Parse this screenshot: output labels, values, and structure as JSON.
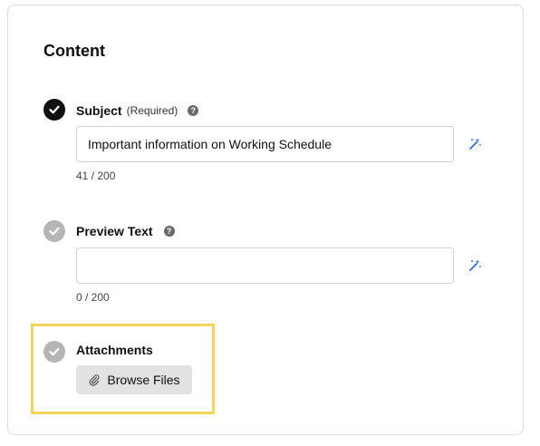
{
  "section": {
    "title": "Content"
  },
  "subject": {
    "label": "Subject",
    "required": "(Required)",
    "value": "Important information on Working Schedule",
    "counter": "41 / 200"
  },
  "preview": {
    "label": "Preview Text",
    "value": "",
    "placeholder": "",
    "counter": "0 / 200"
  },
  "attachments": {
    "label": "Attachments",
    "browse_label": "Browse Files"
  },
  "icons": {
    "help": "question-mark-icon",
    "magic": "magic-wand-icon",
    "check": "checkmark-icon",
    "clip": "paperclip-icon"
  },
  "colors": {
    "complete": "#111111",
    "incomplete": "#b5b5b5",
    "accent": "#2d6fd6",
    "highlight": "#f2d65a"
  }
}
